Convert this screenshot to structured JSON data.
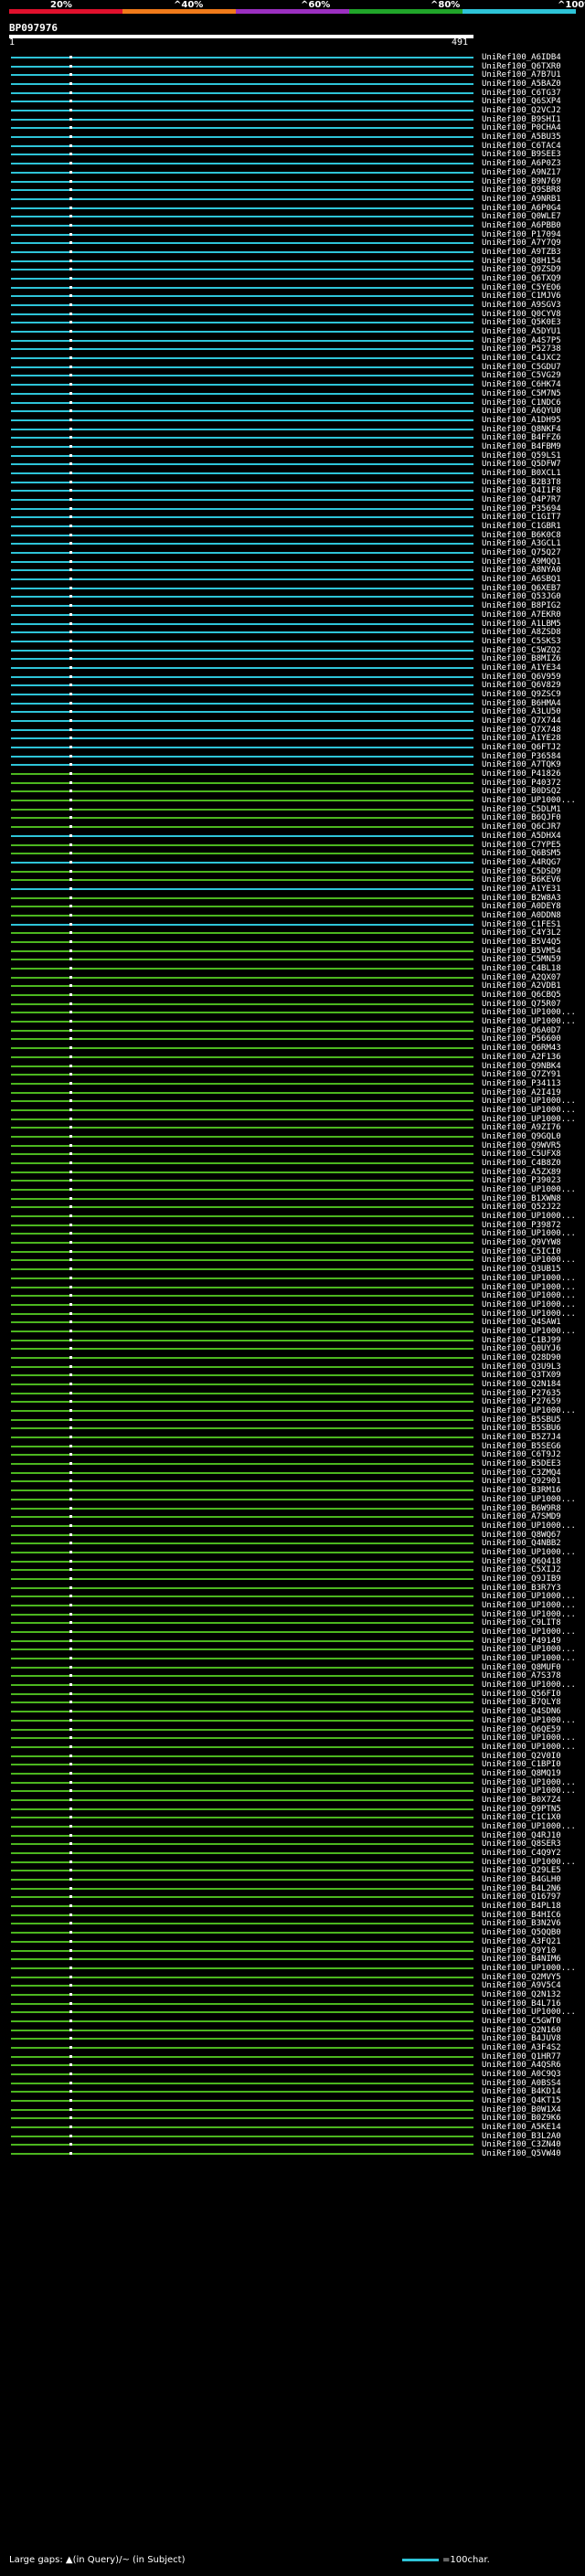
{
  "header": {
    "query_id": "BP097976",
    "start_pos": "1",
    "end_pos": "491",
    "scale_labels": [
      "20%",
      "^40%",
      "^60%",
      "^80%",
      "^100%"
    ],
    "scale_colors": [
      "#e0102c",
      "#f07a1a",
      "#9b2fc0",
      "#21a52a",
      "#2ec4d8"
    ]
  },
  "colors": {
    "high": "#2ec4d8",
    "medium": "#4cb61f"
  },
  "hits": [
    {
      "id": "UniRef100_A6IDB4",
      "tier": "high"
    },
    {
      "id": "UniRef100_Q6TXR0",
      "tier": "high"
    },
    {
      "id": "UniRef100_A7B7U1",
      "tier": "high"
    },
    {
      "id": "UniRef100_A5BAZ0",
      "tier": "high"
    },
    {
      "id": "UniRef100_C6TG37",
      "tier": "high"
    },
    {
      "id": "UniRef100_Q6SXP4",
      "tier": "high"
    },
    {
      "id": "UniRef100_Q2VCJ2",
      "tier": "high"
    },
    {
      "id": "UniRef100_B9SHI1",
      "tier": "high"
    },
    {
      "id": "UniRef100_P0CHA4",
      "tier": "high"
    },
    {
      "id": "UniRef100_A5BU35",
      "tier": "high"
    },
    {
      "id": "UniRef100_C6TAC4",
      "tier": "high"
    },
    {
      "id": "UniRef100_B9SEE3",
      "tier": "high"
    },
    {
      "id": "UniRef100_A6P0Z3",
      "tier": "high"
    },
    {
      "id": "UniRef100_A9NZ17",
      "tier": "high"
    },
    {
      "id": "UniRef100_B9N769",
      "tier": "high"
    },
    {
      "id": "UniRef100_Q9SBR8",
      "tier": "high"
    },
    {
      "id": "UniRef100_A9NRB1",
      "tier": "high"
    },
    {
      "id": "UniRef100_A6P0G4",
      "tier": "high"
    },
    {
      "id": "UniRef100_Q0WLE7",
      "tier": "high"
    },
    {
      "id": "UniRef100_A6PBB0",
      "tier": "high"
    },
    {
      "id": "UniRef100_P17094",
      "tier": "high"
    },
    {
      "id": "UniRef100_A7Y7Q9",
      "tier": "high"
    },
    {
      "id": "UniRef100_A9TZB3",
      "tier": "high"
    },
    {
      "id": "UniRef100_Q8H154",
      "tier": "high"
    },
    {
      "id": "UniRef100_Q9ZSD9",
      "tier": "high"
    },
    {
      "id": "UniRef100_Q6TXQ9",
      "tier": "high"
    },
    {
      "id": "UniRef100_C5YEO6",
      "tier": "high"
    },
    {
      "id": "UniRef100_C1MJV6",
      "tier": "high"
    },
    {
      "id": "UniRef100_A9SGV3",
      "tier": "high"
    },
    {
      "id": "UniRef100_Q0CYV8",
      "tier": "high"
    },
    {
      "id": "UniRef100_Q5K0E3",
      "tier": "high"
    },
    {
      "id": "UniRef100_A5DYU1",
      "tier": "high"
    },
    {
      "id": "UniRef100_A4S7P5",
      "tier": "high"
    },
    {
      "id": "UniRef100_P52738",
      "tier": "high"
    },
    {
      "id": "UniRef100_C4JXC2",
      "tier": "high"
    },
    {
      "id": "UniRef100_C5GDU7",
      "tier": "high"
    },
    {
      "id": "UniRef100_C5VG29",
      "tier": "high"
    },
    {
      "id": "UniRef100_C6HK74",
      "tier": "high"
    },
    {
      "id": "UniRef100_C5M7N5",
      "tier": "high"
    },
    {
      "id": "UniRef100_C1NDC6",
      "tier": "high"
    },
    {
      "id": "UniRef100_A6QYU0",
      "tier": "high"
    },
    {
      "id": "UniRef100_A1DH95",
      "tier": "high"
    },
    {
      "id": "UniRef100_Q8NKF4",
      "tier": "high"
    },
    {
      "id": "UniRef100_B4FFZ6",
      "tier": "high"
    },
    {
      "id": "UniRef100_B4FBM9",
      "tier": "high"
    },
    {
      "id": "UniRef100_Q59LS1",
      "tier": "high"
    },
    {
      "id": "UniRef100_Q5DFW7",
      "tier": "high"
    },
    {
      "id": "UniRef100_B0XCL1",
      "tier": "high"
    },
    {
      "id": "UniRef100_B2B3T8",
      "tier": "high"
    },
    {
      "id": "UniRef100_Q4I1F8",
      "tier": "high"
    },
    {
      "id": "UniRef100_Q4P7R7",
      "tier": "high"
    },
    {
      "id": "UniRef100_P35694",
      "tier": "high"
    },
    {
      "id": "UniRef100_C1GIT7",
      "tier": "high"
    },
    {
      "id": "UniRef100_C1GBR1",
      "tier": "high"
    },
    {
      "id": "UniRef100_B6K0C8",
      "tier": "high"
    },
    {
      "id": "UniRef100_A3GCL1",
      "tier": "high"
    },
    {
      "id": "UniRef100_Q75Q27",
      "tier": "high"
    },
    {
      "id": "UniRef100_A9MQQ1",
      "tier": "high"
    },
    {
      "id": "UniRef100_A8NYA0",
      "tier": "high"
    },
    {
      "id": "UniRef100_A6SBQ1",
      "tier": "high"
    },
    {
      "id": "UniRef100_Q6XEB7",
      "tier": "high"
    },
    {
      "id": "UniRef100_Q53JG0",
      "tier": "high"
    },
    {
      "id": "UniRef100_B8PIG2",
      "tier": "high"
    },
    {
      "id": "UniRef100_A7EKR0",
      "tier": "high"
    },
    {
      "id": "UniRef100_A1LBM5",
      "tier": "high"
    },
    {
      "id": "UniRef100_A8ZSD8",
      "tier": "high"
    },
    {
      "id": "UniRef100_C5SKS3",
      "tier": "high"
    },
    {
      "id": "UniRef100_C5WZQ2",
      "tier": "high"
    },
    {
      "id": "UniRef100_B8MIZ6",
      "tier": "high"
    },
    {
      "id": "UniRef100_A1YE34",
      "tier": "high"
    },
    {
      "id": "UniRef100_Q6V959",
      "tier": "high"
    },
    {
      "id": "UniRef100_Q6V829",
      "tier": "high"
    },
    {
      "id": "UniRef100_Q9ZSC9",
      "tier": "high"
    },
    {
      "id": "UniRef100_B6HMA4",
      "tier": "high"
    },
    {
      "id": "UniRef100_A3LU50",
      "tier": "high"
    },
    {
      "id": "UniRef100_Q7X744",
      "tier": "high"
    },
    {
      "id": "UniRef100_Q7X748",
      "tier": "high"
    },
    {
      "id": "UniRef100_A1YE28",
      "tier": "high"
    },
    {
      "id": "UniRef100_Q6FTJ2",
      "tier": "high"
    },
    {
      "id": "UniRef100_P36584",
      "tier": "high"
    },
    {
      "id": "UniRef100_A7TQK9",
      "tier": "high"
    },
    {
      "id": "UniRef100_P41826",
      "tier": "medium"
    },
    {
      "id": "UniRef100_P40372",
      "tier": "medium"
    },
    {
      "id": "UniRef100_B0DSQ2",
      "tier": "medium"
    },
    {
      "id": "UniRef100_UP1000...",
      "tier": "medium"
    },
    {
      "id": "UniRef100_C5DLM1",
      "tier": "medium"
    },
    {
      "id": "UniRef100_B6QJF0",
      "tier": "medium"
    },
    {
      "id": "UniRef100_Q6CJR7",
      "tier": "medium"
    },
    {
      "id": "UniRef100_A5DHX4",
      "tier": "high"
    },
    {
      "id": "UniRef100_C7YPE5",
      "tier": "medium"
    },
    {
      "id": "UniRef100_Q6BSM5",
      "tier": "medium"
    },
    {
      "id": "UniRef100_A4RQG7",
      "tier": "high"
    },
    {
      "id": "UniRef100_C5DSD9",
      "tier": "medium"
    },
    {
      "id": "UniRef100_B6KEV6",
      "tier": "medium"
    },
    {
      "id": "UniRef100_A1YE31",
      "tier": "high"
    },
    {
      "id": "UniRef100_B2W8A3",
      "tier": "medium"
    },
    {
      "id": "UniRef100_A0DEY8",
      "tier": "medium"
    },
    {
      "id": "UniRef100_A0DDN8",
      "tier": "medium"
    },
    {
      "id": "UniRef100_C1FES1",
      "tier": "high"
    },
    {
      "id": "UniRef100_C4Y3L2",
      "tier": "medium"
    },
    {
      "id": "UniRef100_B5V4Q5",
      "tier": "medium"
    },
    {
      "id": "UniRef100_B5VM54",
      "tier": "medium"
    },
    {
      "id": "UniRef100_C5MN59",
      "tier": "medium"
    },
    {
      "id": "UniRef100_C4BL18",
      "tier": "medium"
    },
    {
      "id": "UniRef100_A2QX07",
      "tier": "medium"
    },
    {
      "id": "UniRef100_A2VDB1",
      "tier": "medium"
    },
    {
      "id": "UniRef100_Q6CBQ5",
      "tier": "medium"
    },
    {
      "id": "UniRef100_Q75R07",
      "tier": "medium"
    },
    {
      "id": "UniRef100_UP1000...",
      "tier": "medium"
    },
    {
      "id": "UniRef100_UP1000...",
      "tier": "medium"
    },
    {
      "id": "UniRef100_Q6A0D7",
      "tier": "medium"
    },
    {
      "id": "UniRef100_P56600",
      "tier": "medium"
    },
    {
      "id": "UniRef100_Q6RM43",
      "tier": "medium"
    },
    {
      "id": "UniRef100_A2F136",
      "tier": "medium"
    },
    {
      "id": "UniRef100_Q9NBK4",
      "tier": "medium"
    },
    {
      "id": "UniRef100_Q7ZY91",
      "tier": "medium"
    },
    {
      "id": "UniRef100_P34113",
      "tier": "medium"
    },
    {
      "id": "UniRef100_A2I419",
      "tier": "medium"
    },
    {
      "id": "UniRef100_UP1000...",
      "tier": "medium"
    },
    {
      "id": "UniRef100_UP1000...",
      "tier": "medium"
    },
    {
      "id": "UniRef100_UP1000...",
      "tier": "medium"
    },
    {
      "id": "UniRef100_A9ZI76",
      "tier": "medium"
    },
    {
      "id": "UniRef100_Q9GQL0",
      "tier": "medium"
    },
    {
      "id": "UniRef100_Q9WVR5",
      "tier": "medium"
    },
    {
      "id": "UniRef100_C5UFX8",
      "tier": "medium"
    },
    {
      "id": "UniRef100_C4B8Z0",
      "tier": "medium"
    },
    {
      "id": "UniRef100_A5ZX89",
      "tier": "medium"
    },
    {
      "id": "UniRef100_P39023",
      "tier": "medium"
    },
    {
      "id": "UniRef100_UP1000...",
      "tier": "medium"
    },
    {
      "id": "UniRef100_B1XWN8",
      "tier": "medium"
    },
    {
      "id": "UniRef100_Q52J22",
      "tier": "medium"
    },
    {
      "id": "UniRef100_UP1000...",
      "tier": "medium"
    },
    {
      "id": "UniRef100_P39872",
      "tier": "medium"
    },
    {
      "id": "UniRef100_UP1000...",
      "tier": "medium"
    },
    {
      "id": "UniRef100_Q9VYW8",
      "tier": "medium"
    },
    {
      "id": "UniRef100_C5ICI0",
      "tier": "medium"
    },
    {
      "id": "UniRef100_UP1000...",
      "tier": "medium"
    },
    {
      "id": "UniRef100_Q3UB15",
      "tier": "medium"
    },
    {
      "id": "UniRef100_UP1000...",
      "tier": "medium"
    },
    {
      "id": "UniRef100_UP1000...",
      "tier": "medium"
    },
    {
      "id": "UniRef100_UP1000...",
      "tier": "medium"
    },
    {
      "id": "UniRef100_UP1000...",
      "tier": "medium"
    },
    {
      "id": "UniRef100_UP1000...",
      "tier": "medium"
    },
    {
      "id": "UniRef100_Q4SAW1",
      "tier": "medium"
    },
    {
      "id": "UniRef100_UP1000...",
      "tier": "medium"
    },
    {
      "id": "UniRef100_C1BJ99",
      "tier": "medium"
    },
    {
      "id": "UniRef100_Q0UYJ6",
      "tier": "medium"
    },
    {
      "id": "UniRef100_Q28D90",
      "tier": "medium"
    },
    {
      "id": "UniRef100_Q3U9L3",
      "tier": "medium"
    },
    {
      "id": "UniRef100_Q3TX09",
      "tier": "medium"
    },
    {
      "id": "UniRef100_Q2N184",
      "tier": "medium"
    },
    {
      "id": "UniRef100_P27635",
      "tier": "medium"
    },
    {
      "id": "UniRef100_P27659",
      "tier": "medium"
    },
    {
      "id": "UniRef100_UP1000...",
      "tier": "medium"
    },
    {
      "id": "UniRef100_B5SBU5",
      "tier": "medium"
    },
    {
      "id": "UniRef100_B5SBU6",
      "tier": "medium"
    },
    {
      "id": "UniRef100_B5Z7J4",
      "tier": "medium"
    },
    {
      "id": "UniRef100_B5SEG6",
      "tier": "medium"
    },
    {
      "id": "UniRef100_C6T9J2",
      "tier": "medium"
    },
    {
      "id": "UniRef100_B5DEE3",
      "tier": "medium"
    },
    {
      "id": "UniRef100_C3ZMQ4",
      "tier": "medium"
    },
    {
      "id": "UniRef100_Q92901",
      "tier": "medium"
    },
    {
      "id": "UniRef100_B3RM16",
      "tier": "medium"
    },
    {
      "id": "UniRef100_UP1000...",
      "tier": "medium"
    },
    {
      "id": "UniRef100_B6W9R8",
      "tier": "medium"
    },
    {
      "id": "UniRef100_A7SMD9",
      "tier": "medium"
    },
    {
      "id": "UniRef100_UP1000...",
      "tier": "medium"
    },
    {
      "id": "UniRef100_Q8WQ67",
      "tier": "medium"
    },
    {
      "id": "UniRef100_Q4NBB2",
      "tier": "medium"
    },
    {
      "id": "UniRef100_UP1000...",
      "tier": "medium"
    },
    {
      "id": "UniRef100_Q6Q418",
      "tier": "medium"
    },
    {
      "id": "UniRef100_C5XIJ2",
      "tier": "medium"
    },
    {
      "id": "UniRef100_Q9JIB9",
      "tier": "medium"
    },
    {
      "id": "UniRef100_B3R7Y3",
      "tier": "medium"
    },
    {
      "id": "UniRef100_UP1000...",
      "tier": "medium"
    },
    {
      "id": "UniRef100_UP1000...",
      "tier": "medium"
    },
    {
      "id": "UniRef100_UP1000...",
      "tier": "medium"
    },
    {
      "id": "UniRef100_C9LIT8",
      "tier": "medium"
    },
    {
      "id": "UniRef100_UP1000...",
      "tier": "medium"
    },
    {
      "id": "UniRef100_P49149",
      "tier": "medium"
    },
    {
      "id": "UniRef100_UP1000...",
      "tier": "medium"
    },
    {
      "id": "UniRef100_UP1000...",
      "tier": "medium"
    },
    {
      "id": "UniRef100_Q8MUF0",
      "tier": "medium"
    },
    {
      "id": "UniRef100_A7S378",
      "tier": "medium"
    },
    {
      "id": "UniRef100_UP1000...",
      "tier": "medium"
    },
    {
      "id": "UniRef100_Q56FI0",
      "tier": "medium"
    },
    {
      "id": "UniRef100_B7QLY8",
      "tier": "medium"
    },
    {
      "id": "UniRef100_Q4SDN6",
      "tier": "medium"
    },
    {
      "id": "UniRef100_UP1000...",
      "tier": "medium"
    },
    {
      "id": "UniRef100_Q6QE59",
      "tier": "medium"
    },
    {
      "id": "UniRef100_UP1000...",
      "tier": "medium"
    },
    {
      "id": "UniRef100_UP1000...",
      "tier": "medium"
    },
    {
      "id": "UniRef100_Q2V0I0",
      "tier": "medium"
    },
    {
      "id": "UniRef100_C1BPI0",
      "tier": "medium"
    },
    {
      "id": "UniRef100_Q8MQ19",
      "tier": "medium"
    },
    {
      "id": "UniRef100_UP1000...",
      "tier": "medium"
    },
    {
      "id": "UniRef100_UP1000...",
      "tier": "medium"
    },
    {
      "id": "UniRef100_B0X7Z4",
      "tier": "medium"
    },
    {
      "id": "UniRef100_Q9PTN5",
      "tier": "medium"
    },
    {
      "id": "UniRef100_C1C1X0",
      "tier": "medium"
    },
    {
      "id": "UniRef100_UP1000...",
      "tier": "medium"
    },
    {
      "id": "UniRef100_Q4RJ10",
      "tier": "medium"
    },
    {
      "id": "UniRef100_Q8SER3",
      "tier": "medium"
    },
    {
      "id": "UniRef100_C4Q9Y2",
      "tier": "medium"
    },
    {
      "id": "UniRef100_UP1000...",
      "tier": "medium"
    },
    {
      "id": "UniRef100_Q29LE5",
      "tier": "medium"
    },
    {
      "id": "UniRef100_B4GLH0",
      "tier": "medium"
    },
    {
      "id": "UniRef100_B4L2N6",
      "tier": "medium"
    },
    {
      "id": "UniRef100_Q16797",
      "tier": "medium"
    },
    {
      "id": "UniRef100_B4PL18",
      "tier": "medium"
    },
    {
      "id": "UniRef100_B4HIC6",
      "tier": "medium"
    },
    {
      "id": "UniRef100_B3N2V6",
      "tier": "medium"
    },
    {
      "id": "UniRef100_Q5QQB0",
      "tier": "medium"
    },
    {
      "id": "UniRef100_A3FQ21",
      "tier": "medium"
    },
    {
      "id": "UniRef100_Q9Y10",
      "tier": "medium"
    },
    {
      "id": "UniRef100_B4NIM6",
      "tier": "medium"
    },
    {
      "id": "UniRef100_UP1000...",
      "tier": "medium"
    },
    {
      "id": "UniRef100_Q2MVY5",
      "tier": "medium"
    },
    {
      "id": "UniRef100_A9V5C4",
      "tier": "medium"
    },
    {
      "id": "UniRef100_Q2N132",
      "tier": "medium"
    },
    {
      "id": "UniRef100_B4L716",
      "tier": "medium"
    },
    {
      "id": "UniRef100_UP1000...",
      "tier": "medium"
    },
    {
      "id": "UniRef100_C5GWT0",
      "tier": "medium"
    },
    {
      "id": "UniRef100_Q2N160",
      "tier": "medium"
    },
    {
      "id": "UniRef100_B4JUV8",
      "tier": "medium"
    },
    {
      "id": "UniRef100_A3F4S2",
      "tier": "medium"
    },
    {
      "id": "UniRef100_Q1HR77",
      "tier": "medium"
    },
    {
      "id": "UniRef100_A4QSR6",
      "tier": "medium"
    },
    {
      "id": "UniRef100_A0C9Q3",
      "tier": "medium"
    },
    {
      "id": "UniRef100_A0BSS4",
      "tier": "medium"
    },
    {
      "id": "UniRef100_B4KD14",
      "tier": "medium"
    },
    {
      "id": "UniRef100_Q4KT15",
      "tier": "medium"
    },
    {
      "id": "UniRef100_B0W1X4",
      "tier": "medium"
    },
    {
      "id": "UniRef100_B0Z9K6",
      "tier": "medium"
    },
    {
      "id": "UniRef100_A5KE14",
      "tier": "medium"
    },
    {
      "id": "UniRef100_B3L2A0",
      "tier": "medium"
    },
    {
      "id": "UniRef100_C3ZN40",
      "tier": "medium"
    },
    {
      "id": "UniRef100_Q5VW40",
      "tier": "medium"
    }
  ],
  "footer": {
    "gaps_text": "Large gaps: ▲(in Query)/~ (in Subject)",
    "legend_text": "=100char."
  }
}
